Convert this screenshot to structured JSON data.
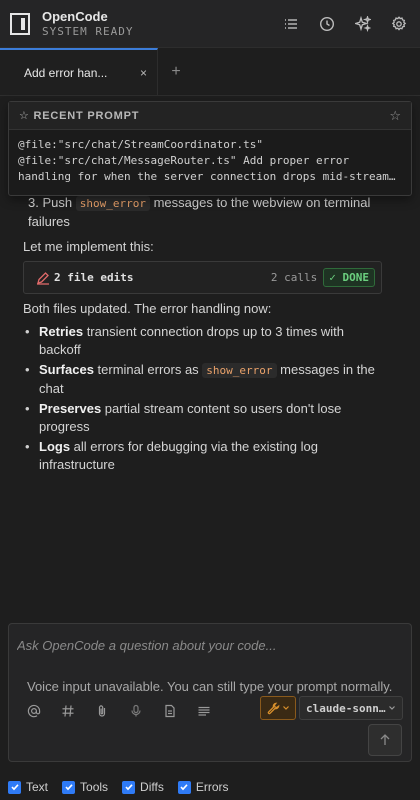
{
  "app": {
    "name": "OpenCode",
    "status": "SYSTEM READY"
  },
  "header_icons": [
    "list-icon",
    "history-icon",
    "sparkle-icon",
    "gear-icon"
  ],
  "tabs": [
    {
      "label": "Add error han...",
      "active": true
    }
  ],
  "tab_add": "+",
  "tab_close": "×",
  "recent_prompt": {
    "title": "☆ RECENT PROMPT",
    "star": "☆",
    "lines": [
      "@file:\"src/chat/StreamCoordinator.ts\"",
      "@file:\"src/chat/MessageRouter.ts\" Add proper error",
      "handling for when the server connection drops mid-stream...."
    ]
  },
  "conversation": {
    "partial_item": {
      "number": "3.",
      "pre": "Push",
      "code": "show_error",
      "post": "messages to the webview on terminal failures"
    },
    "intro": "Let me implement this:",
    "tool_card": {
      "label": "2 file edits",
      "calls": "2 calls",
      "status": "✓ DONE"
    },
    "summary": "Both files updated. The error handling now:",
    "bullets": [
      {
        "bold": "Retries",
        "text": " transient connection drops up to 3 times with backoff"
      },
      {
        "bold": "Surfaces",
        "pre": " terminal errors as ",
        "code": "show_error",
        "text": " messages in the chat"
      },
      {
        "bold": "Preserves",
        "text": " partial stream content so users don't lose progress"
      },
      {
        "bold": "Logs",
        "text": " all errors for debugging via the existing log infrastructure"
      }
    ]
  },
  "composer": {
    "placeholder": "Ask OpenCode a question about your code...",
    "voice_message": "Voice input unavailable. You can still type your prompt normally.",
    "model": "claude-sonn...",
    "tool_icons": [
      "at-icon",
      "hash-icon",
      "paperclip-icon",
      "mic-icon",
      "file-icon",
      "terminal-icon"
    ]
  },
  "filters": [
    {
      "label": "Text",
      "checked": true
    },
    {
      "label": "Tools",
      "checked": true
    },
    {
      "label": "Diffs",
      "checked": true
    },
    {
      "label": "Errors",
      "checked": true
    }
  ],
  "colors": {
    "background": "#1e1e1e",
    "accent": "#3c7dd9",
    "done": "#6bcf7f",
    "code": "#e9a16a",
    "checkbox": "#2f7bf6",
    "wrench": "#d9902c"
  }
}
